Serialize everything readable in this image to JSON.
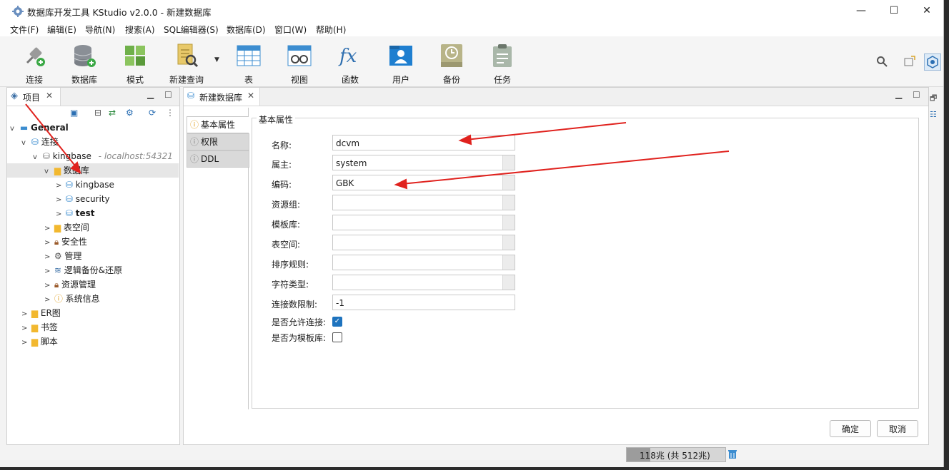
{
  "window": {
    "title": "数据库开发工具 KStudio v2.0.0 - 新建数据库",
    "minimize": "—",
    "maximize": "☐",
    "close": "✕"
  },
  "menu": [
    "文件(F)",
    "编辑(E)",
    "导航(N)",
    "搜索(A)",
    "SQL编辑器(S)",
    "数据库(D)",
    "窗口(W)",
    "帮助(H)"
  ],
  "toolbar": [
    {
      "label": "连接",
      "icon": "plug-icon"
    },
    {
      "label": "数据库",
      "icon": "database-add-icon"
    },
    {
      "label": "模式",
      "icon": "schema-icon"
    },
    {
      "label": "新建查询",
      "icon": "new-query-icon"
    },
    {
      "label": "表",
      "icon": "table-icon"
    },
    {
      "label": "视图",
      "icon": "view-icon"
    },
    {
      "label": "函数",
      "icon": "function-icon"
    },
    {
      "label": "用户",
      "icon": "user-icon"
    },
    {
      "label": "备份",
      "icon": "backup-icon"
    },
    {
      "label": "任务",
      "icon": "task-icon"
    }
  ],
  "project": {
    "tab_label": "项目",
    "tree": [
      {
        "label": "General",
        "bold": true,
        "icon": "folder-general-icon"
      },
      {
        "label": "连接",
        "icon": "connection-icon"
      },
      {
        "label": "kingbase",
        "suffix": "- localhost:54321",
        "icon": "server-icon"
      },
      {
        "label": "数据库",
        "icon": "folder-db-icon"
      },
      {
        "label": "kingbase",
        "icon": "database-icon"
      },
      {
        "label": "security",
        "icon": "database-icon"
      },
      {
        "label": "test",
        "bold": true,
        "icon": "database-icon"
      },
      {
        "label": "表空间",
        "icon": "folder-icon"
      },
      {
        "label": "安全性",
        "icon": "lock-icon"
      },
      {
        "label": "管理",
        "icon": "gear-icon"
      },
      {
        "label": "逻辑备份&还原",
        "icon": "layers-icon"
      },
      {
        "label": "资源管理",
        "icon": "lock-icon"
      },
      {
        "label": "系统信息",
        "icon": "info-icon"
      },
      {
        "label": "ER图",
        "icon": "folder-er-icon"
      },
      {
        "label": "书签",
        "icon": "folder-icon"
      },
      {
        "label": "脚本",
        "icon": "folder-icon"
      }
    ]
  },
  "editor": {
    "tab_label": "新建数据库",
    "side_tabs": [
      "基本属性",
      "权限",
      "DDL"
    ],
    "group_title": "基本属性",
    "fields": [
      {
        "label": "名称:",
        "value": "dcvm"
      },
      {
        "label": "属主:",
        "value": "system"
      },
      {
        "label": "编码:",
        "value": "GBK"
      },
      {
        "label": "资源组:",
        "value": ""
      },
      {
        "label": "模板库:",
        "value": ""
      },
      {
        "label": "表空间:",
        "value": ""
      },
      {
        "label": "排序规则:",
        "value": ""
      },
      {
        "label": "字符类型:",
        "value": ""
      },
      {
        "label": "连接数限制:",
        "value": "-1"
      }
    ],
    "checks": [
      {
        "label": "是否允许连接:",
        "checked": true
      },
      {
        "label": "是否为模板库:",
        "checked": false
      }
    ],
    "ok": "确定",
    "cancel": "取消"
  },
  "status": {
    "memory": "118兆 (共 512兆)"
  },
  "colors": {
    "accent": "#1e73be",
    "arrow": "#e0221e",
    "folder": "#f2b82f"
  }
}
